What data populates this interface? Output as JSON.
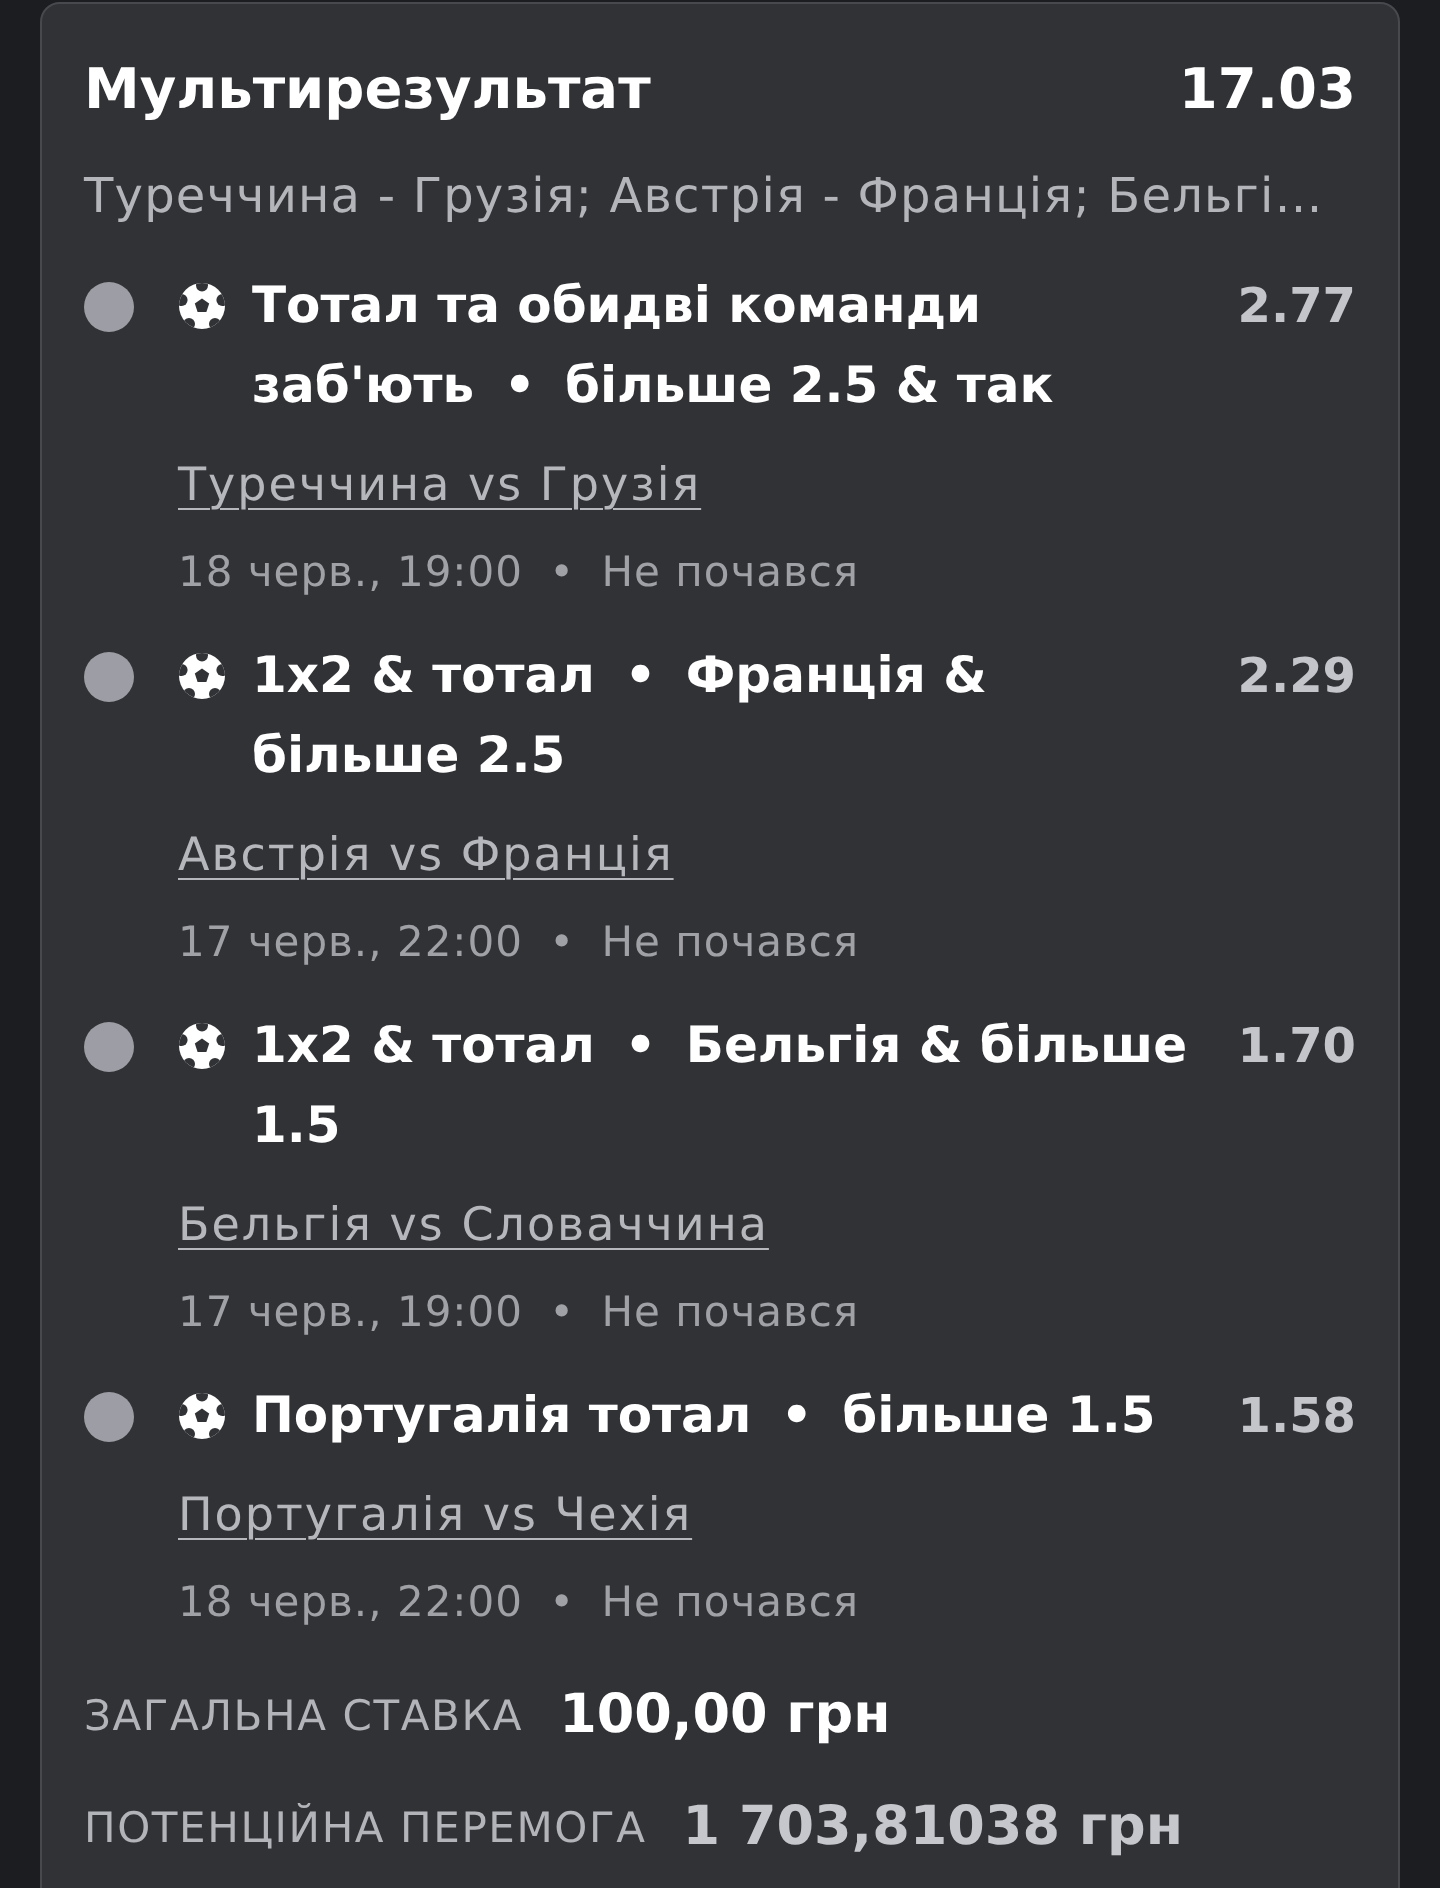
{
  "bet": {
    "title": "Мультирезультат",
    "total_odds": "17.03",
    "events_summary": "Туреччина - Грузія; Австрія - Франція; Бельгі…"
  },
  "legs": [
    {
      "color": "#9d9ea5",
      "kind": "football",
      "market": "Тотал та обидві команди заб'ють",
      "separator": "•",
      "selection": "більше 2.5 & так",
      "odds": "2.77",
      "match": "Туреччина vs Грузія",
      "date": "18 черв., 19:00",
      "info_separator": "•",
      "status": "Не почався"
    },
    {
      "color": "#9d9ea5",
      "kind": "football",
      "market": "1x2 & тотал",
      "separator": "•",
      "selection": "Франція & більше 2.5",
      "odds": "2.29",
      "match": "Австрія vs Франція",
      "date": "17 черв., 22:00",
      "info_separator": "•",
      "status": "Не почався"
    },
    {
      "color": "#9d9ea5",
      "kind": "football",
      "market": "1x2 & тотал",
      "separator": "•",
      "selection": "Бельгія & більше 1.5",
      "odds": "1.70",
      "match": "Бельгія vs Словаччина",
      "date": "17 черв., 19:00",
      "info_separator": "•",
      "status": "Не почався"
    },
    {
      "color": "#9d9ea5",
      "kind": "football",
      "market": "Португалія тотал",
      "separator": "•",
      "selection": "більше 1.5",
      "odds": "1.58",
      "match": "Португалія vs Чехія",
      "date": "18 черв., 22:00",
      "info_separator": "•",
      "status": "Не почався"
    }
  ],
  "summary": [
    {
      "kind": "stake",
      "label": "ЗАГАЛЬНА СТАВКА",
      "value": "100,00 грн"
    },
    {
      "kind": "payout",
      "label": "ПОТЕНЦІЙНА ПЕРЕМОГА",
      "value": "1 703,81038 грн"
    }
  ]
}
